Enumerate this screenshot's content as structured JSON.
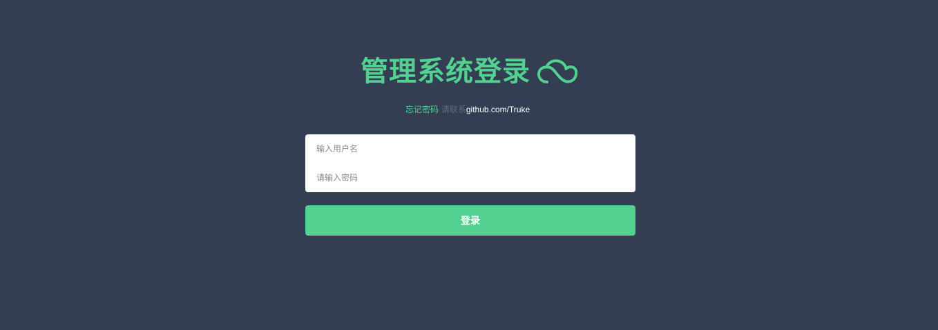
{
  "header": {
    "title": "管理系统登录",
    "icon": "cloud-icon",
    "accent_color": "#52d190"
  },
  "hint": {
    "forgot_label": "忘记密码",
    "contact_label": "请联系",
    "link_text": "github.com/Truke"
  },
  "form": {
    "username_placeholder": "输入用户名",
    "password_placeholder": "请输入密码",
    "username_value": "",
    "password_value": ""
  },
  "actions": {
    "login_label": "登录"
  },
  "colors": {
    "background": "#343e53",
    "accent": "#52d190",
    "input_background": "#ffffff",
    "muted_text": "#5f6a7d"
  }
}
